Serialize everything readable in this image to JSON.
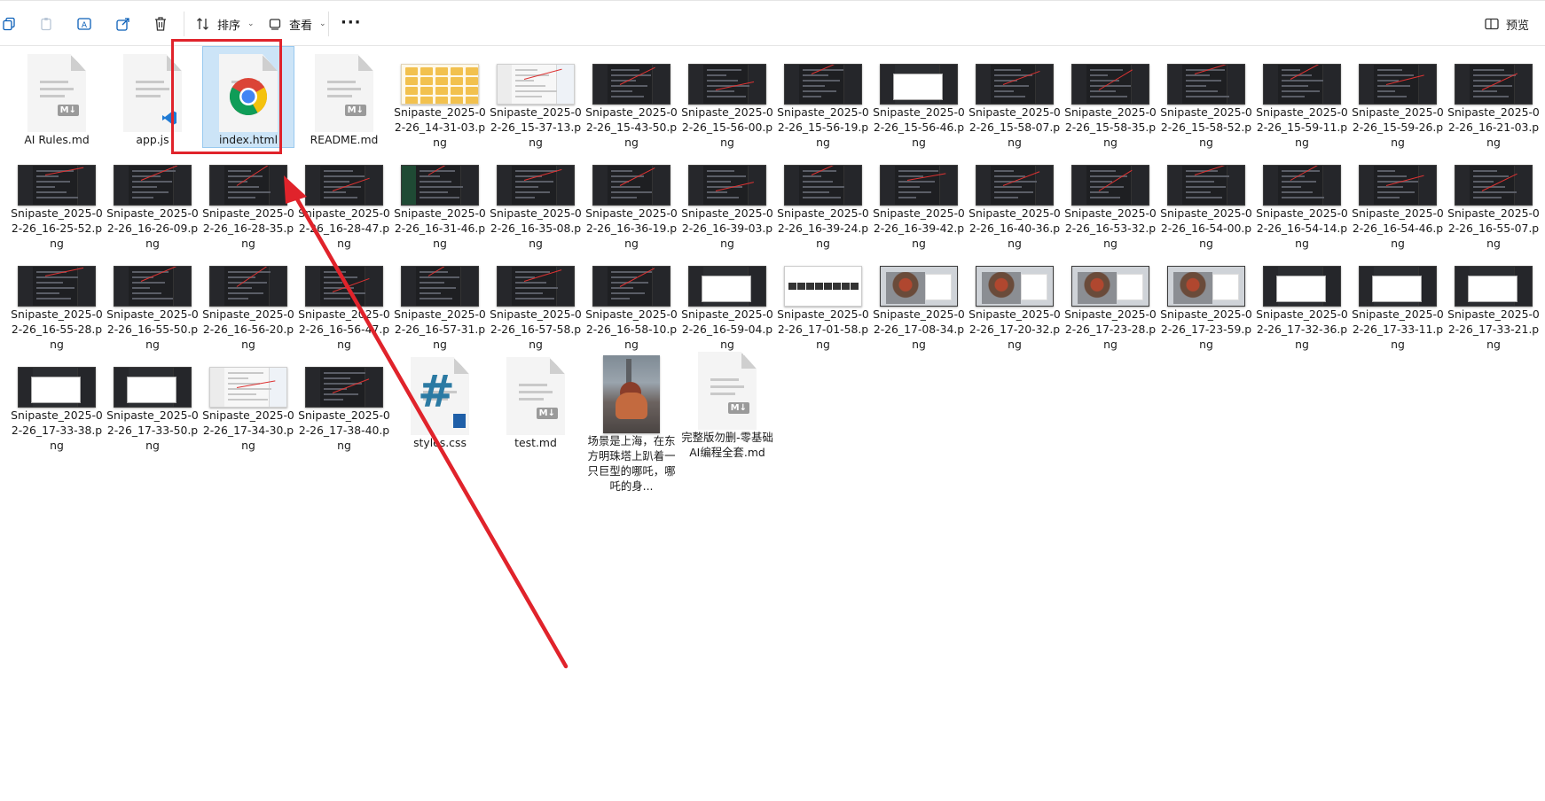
{
  "toolbar": {
    "sort_label": "排序",
    "view_label": "查看",
    "more_label": "···",
    "preview_label": "预览"
  },
  "files": [
    {
      "name": "AI Rules.md",
      "kind": "md"
    },
    {
      "name": "app.js",
      "kind": "js"
    },
    {
      "name": "index.html",
      "kind": "html",
      "selected": true
    },
    {
      "name": "README.md",
      "kind": "md"
    },
    {
      "name": "Snipaste_2025-02-26_14-31-03.png",
      "kind": "folders"
    },
    {
      "name": "Snipaste_2025-02-26_15-37-13.png",
      "kind": "light"
    },
    {
      "name": "Snipaste_2025-02-26_15-43-50.png",
      "kind": "dark"
    },
    {
      "name": "Snipaste_2025-02-26_15-56-00.png",
      "kind": "dark"
    },
    {
      "name": "Snipaste_2025-02-26_15-56-19.png",
      "kind": "dark"
    },
    {
      "name": "Snipaste_2025-02-26_15-56-46.png",
      "kind": "win"
    },
    {
      "name": "Snipaste_2025-02-26_15-58-07.png",
      "kind": "dark"
    },
    {
      "name": "Snipaste_2025-02-26_15-58-35.png",
      "kind": "dark"
    },
    {
      "name": "Snipaste_2025-02-26_15-58-52.png",
      "kind": "dark"
    },
    {
      "name": "Snipaste_2025-02-26_15-59-11.png",
      "kind": "dark"
    },
    {
      "name": "Snipaste_2025-02-26_15-59-26.png",
      "kind": "dark"
    },
    {
      "name": "Snipaste_2025-02-26_16-21-03.png",
      "kind": "dark"
    },
    {
      "name": "Snipaste_2025-02-26_16-25-52.png",
      "kind": "dark"
    },
    {
      "name": "Snipaste_2025-02-26_16-26-09.png",
      "kind": "dark"
    },
    {
      "name": "Snipaste_2025-02-26_16-28-35.png",
      "kind": "dark"
    },
    {
      "name": "Snipaste_2025-02-26_16-28-47.png",
      "kind": "dark"
    },
    {
      "name": "Snipaste_2025-02-26_16-31-46.png",
      "kind": "green"
    },
    {
      "name": "Snipaste_2025-02-26_16-35-08.png",
      "kind": "dark"
    },
    {
      "name": "Snipaste_2025-02-26_16-36-19.png",
      "kind": "dark"
    },
    {
      "name": "Snipaste_2025-02-26_16-39-03.png",
      "kind": "dark"
    },
    {
      "name": "Snipaste_2025-02-26_16-39-24.png",
      "kind": "dark"
    },
    {
      "name": "Snipaste_2025-02-26_16-39-42.png",
      "kind": "dark"
    },
    {
      "name": "Snipaste_2025-02-26_16-40-36.png",
      "kind": "dark"
    },
    {
      "name": "Snipaste_2025-02-26_16-53-32.png",
      "kind": "dark"
    },
    {
      "name": "Snipaste_2025-02-26_16-54-00.png",
      "kind": "dark"
    },
    {
      "name": "Snipaste_2025-02-26_16-54-14.png",
      "kind": "dark"
    },
    {
      "name": "Snipaste_2025-02-26_16-54-46.png",
      "kind": "dark"
    },
    {
      "name": "Snipaste_2025-02-26_16-55-07.png",
      "kind": "dark"
    },
    {
      "name": "Snipaste_2025-02-26_16-55-28.png",
      "kind": "dark"
    },
    {
      "name": "Snipaste_2025-02-26_16-55-50.png",
      "kind": "dark"
    },
    {
      "name": "Snipaste_2025-02-26_16-56-20.png",
      "kind": "dark"
    },
    {
      "name": "Snipaste_2025-02-26_16-56-47.png",
      "kind": "dark"
    },
    {
      "name": "Snipaste_2025-02-26_16-57-31.png",
      "kind": "dark"
    },
    {
      "name": "Snipaste_2025-02-26_16-57-58.png",
      "kind": "dark"
    },
    {
      "name": "Snipaste_2025-02-26_16-58-10.png",
      "kind": "dark"
    },
    {
      "name": "Snipaste_2025-02-26_16-59-04.png",
      "kind": "win"
    },
    {
      "name": "Snipaste_2025-02-26_17-01-58.png",
      "kind": "strip"
    },
    {
      "name": "Snipaste_2025-02-26_17-08-34.png",
      "kind": "photo"
    },
    {
      "name": "Snipaste_2025-02-26_17-20-32.png",
      "kind": "photo"
    },
    {
      "name": "Snipaste_2025-02-26_17-23-28.png",
      "kind": "photo"
    },
    {
      "name": "Snipaste_2025-02-26_17-23-59.png",
      "kind": "photo"
    },
    {
      "name": "Snipaste_2025-02-26_17-32-36.png",
      "kind": "win"
    },
    {
      "name": "Snipaste_2025-02-26_17-33-11.png",
      "kind": "win"
    },
    {
      "name": "Snipaste_2025-02-26_17-33-21.png",
      "kind": "win"
    },
    {
      "name": "Snipaste_2025-02-26_17-33-38.png",
      "kind": "win"
    },
    {
      "name": "Snipaste_2025-02-26_17-33-50.png",
      "kind": "win"
    },
    {
      "name": "Snipaste_2025-02-26_17-34-30.png",
      "kind": "light"
    },
    {
      "name": "Snipaste_2025-02-26_17-38-40.png",
      "kind": "dark"
    },
    {
      "name": "styles.css",
      "kind": "css"
    },
    {
      "name": "test.md",
      "kind": "md"
    },
    {
      "name": "场景是上海，在东方明珠塔上趴着一只巨型的哪吒，哪吒的身...",
      "kind": "phototall"
    },
    {
      "name": "完整版勿删-零基础AI编程全套.md",
      "kind": "md"
    }
  ]
}
